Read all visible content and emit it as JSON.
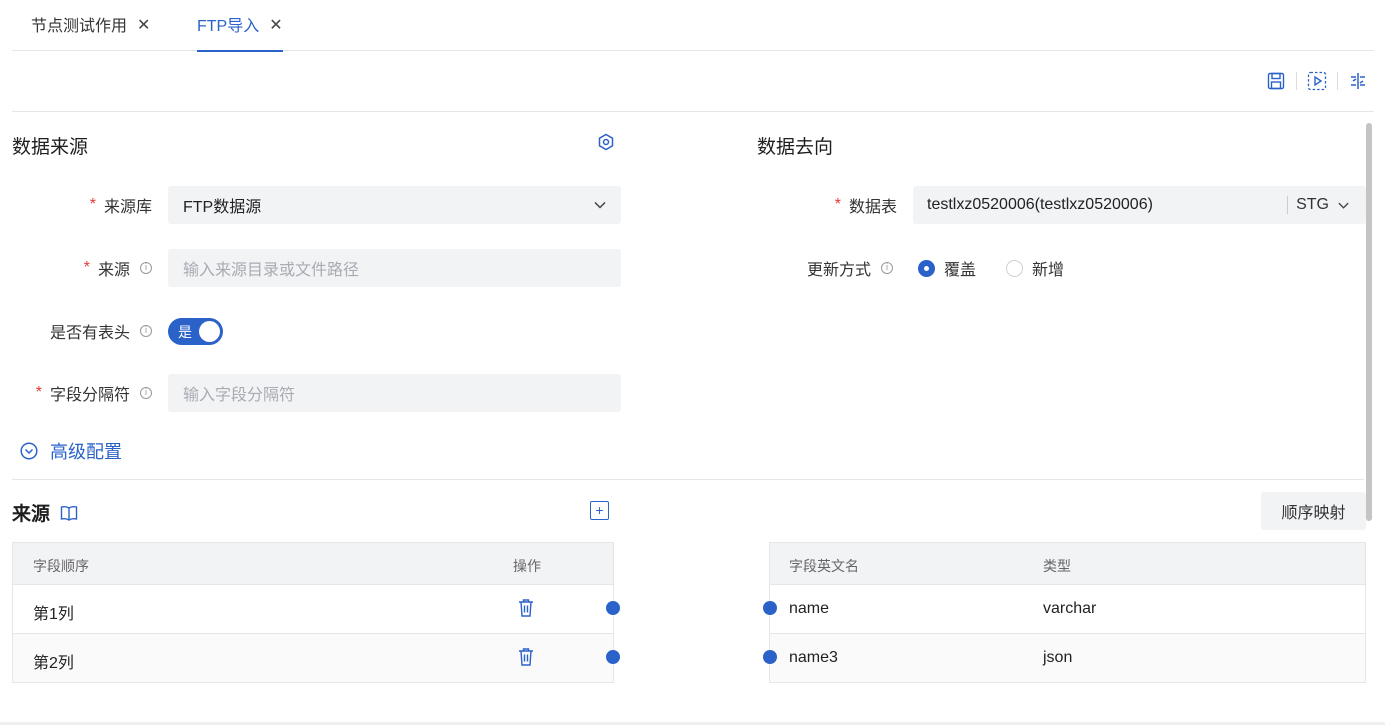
{
  "tabs": [
    {
      "label": "节点测试作用",
      "close": "✕"
    },
    {
      "label": "FTP导入",
      "close": "✕"
    }
  ],
  "toolbar": {
    "icons": [
      "save-icon",
      "run-icon",
      "debug-icon"
    ]
  },
  "source_section": {
    "title": "数据来源",
    "fields": {
      "source_db": {
        "label": "来源库",
        "value": "FTP数据源"
      },
      "source": {
        "label": "来源",
        "placeholder": "输入来源目录或文件路径"
      },
      "has_header": {
        "label": "是否有表头",
        "toggle_label": "是",
        "on": true
      },
      "delimiter": {
        "label": "字段分隔符",
        "placeholder": "输入字段分隔符"
      }
    },
    "advanced_label": "高级配置"
  },
  "target_section": {
    "title": "数据去向",
    "table_field": {
      "label": "数据表",
      "value": "testlxz0520006(testlxz0520006)",
      "schema": "STG"
    },
    "update_mode": {
      "label": "更新方式",
      "options": [
        "覆盖",
        "新增"
      ],
      "selected": "覆盖"
    }
  },
  "source_table": {
    "title": "来源",
    "add_label": "+",
    "headers": [
      "字段顺序",
      "操作"
    ],
    "rows": [
      {
        "order": "第1列"
      },
      {
        "order": "第2列"
      }
    ]
  },
  "target_table": {
    "seq_map_label": "顺序映射",
    "headers": [
      "字段英文名",
      "类型"
    ],
    "rows": [
      {
        "name": "name",
        "type": "varchar"
      },
      {
        "name": "name3",
        "type": "json"
      }
    ]
  },
  "common": {
    "required_mark": "*",
    "info_mark": "i"
  },
  "colors": {
    "accent": "#2a62c9",
    "required": "#e53935"
  }
}
